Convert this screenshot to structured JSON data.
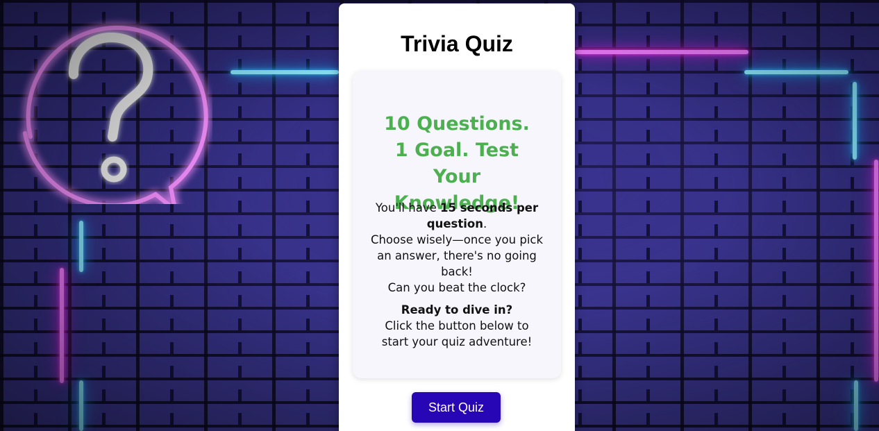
{
  "title": "Trivia Quiz",
  "intro": {
    "headline": "10 Questions. 1 Goal. Test Your Knowledge!",
    "line1_prefix": "You'll have ",
    "line1_bold": "15 seconds per question",
    "line1_suffix": ".",
    "line2": "Choose wisely—once you pick an answer, there's no going back!",
    "line3": "Can you beat the clock?",
    "ready_bold": "Ready to dive in?",
    "ready_text": "Click the button below to start your quiz adventure!"
  },
  "start_button_label": "Start Quiz",
  "colors": {
    "headline": "#4caf50",
    "button": "#2706b5",
    "neon_pink": "#e21de0",
    "neon_blue": "#1aa6f0"
  },
  "icons": {
    "background": "neon-question-bubble-icon"
  }
}
